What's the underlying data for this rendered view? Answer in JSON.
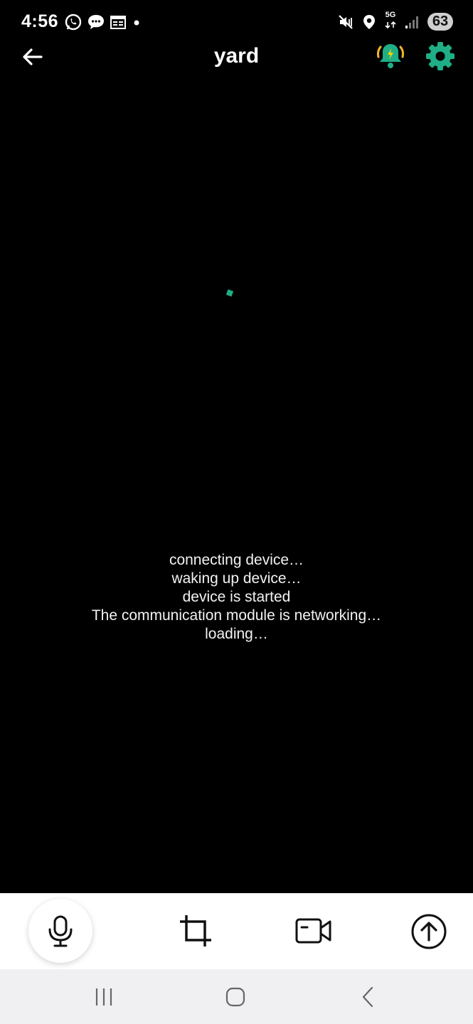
{
  "status_bar": {
    "time": "4:56",
    "left_icons": [
      "whatsapp-icon",
      "message-icon",
      "calendar-icon",
      "dot-icon"
    ],
    "right_icons": [
      "mute-vibrate-icon",
      "location-icon",
      "5g-icon",
      "signal-icon"
    ],
    "network_label": "5G",
    "battery": "63"
  },
  "header": {
    "title": "yard",
    "alarm_icon": "alarm-bell-icon",
    "settings_icon": "gear-icon",
    "accent_color": "#1fae86",
    "alarm_ring_color": "#f0b429"
  },
  "video": {
    "messages": [
      "connecting device…",
      "waking up device…",
      "device is started",
      "The communication module is networking…",
      "loading…"
    ]
  },
  "toolbar": {
    "icons": [
      "microphone-icon",
      "crop-icon",
      "video-record-icon",
      "upload-arrow-icon"
    ]
  },
  "nav_bar": {
    "icons": [
      "recent-apps-icon",
      "home-icon",
      "back-nav-icon"
    ]
  }
}
